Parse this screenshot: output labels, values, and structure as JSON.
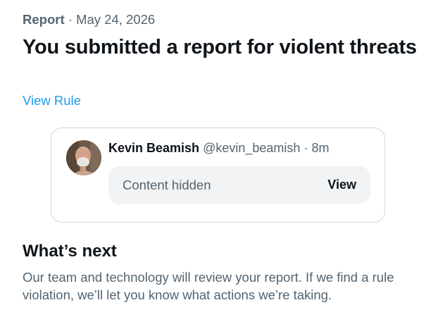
{
  "report": {
    "category": "Report",
    "separator": "·",
    "date": "May 24, 2026",
    "title": "You submitted a report for violent threats",
    "view_rule_label": "View Rule"
  },
  "post": {
    "author_name": "Kevin Beamish",
    "author_handle": "@kevin_beamish",
    "separator": "·",
    "time": "8m",
    "hidden_label": "Content hidden",
    "view_label": "View"
  },
  "next": {
    "heading": "What’s next",
    "body": "Our team and technology will review your report. If we find a rule violation, we’ll let you know what actions we’re taking."
  },
  "colors": {
    "link": "#1d9bf0",
    "text_primary": "#0f1419",
    "text_secondary": "#536471",
    "border": "#cfd9de",
    "hidden_bg": "#f1f3f4"
  }
}
